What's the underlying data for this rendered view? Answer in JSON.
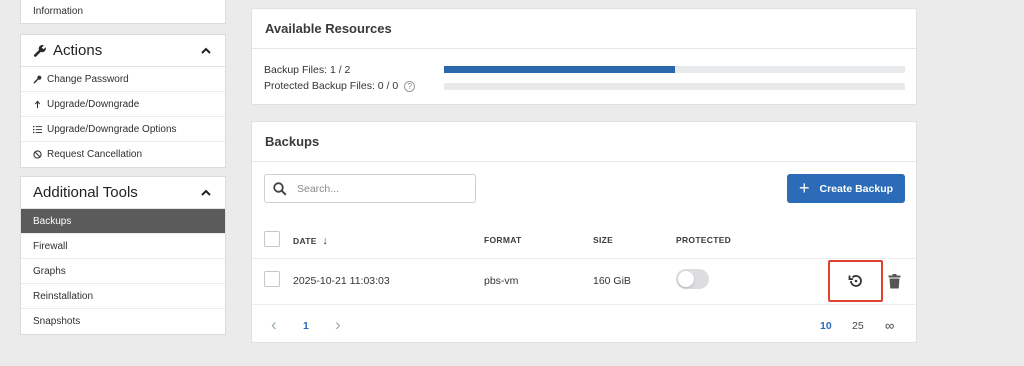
{
  "sidebar": {
    "top_item": "Information",
    "actions": {
      "title": "Actions",
      "items": [
        {
          "label": "Change Password",
          "icon": "key-icon"
        },
        {
          "label": "Upgrade/Downgrade",
          "icon": "arrow-up-icon"
        },
        {
          "label": "Upgrade/Downgrade Options",
          "icon": "list-icon"
        },
        {
          "label": "Request Cancellation",
          "icon": "ban-icon"
        }
      ]
    },
    "tools": {
      "title": "Additional Tools",
      "items": [
        "Backups",
        "Firewall",
        "Graphs",
        "Reinstallation",
        "Snapshots"
      ],
      "active": "Backups"
    }
  },
  "resources": {
    "title": "Available Resources",
    "backup_files_label": "Backup Files: 1 / 2",
    "backup_files_fraction": 0.5,
    "protected_label": "Protected Backup Files: 0 / 0",
    "protected_fraction": 0,
    "help_glyph": "?"
  },
  "backups": {
    "title": "Backups",
    "search_placeholder": "Search...",
    "create_label": "Create Backup",
    "columns": {
      "date": "DATE",
      "date_sort": "↓",
      "format": "FORMAT",
      "size": "SIZE",
      "protected": "PROTECTED"
    },
    "rows": [
      {
        "date": "2025-10-21 11:03:03",
        "format": "pbs-vm",
        "size": "160 GiB",
        "protected": false
      }
    ],
    "pagination": {
      "prev": "‹",
      "current_page": "1",
      "next": "›",
      "per_page_options": [
        "10",
        "25",
        "∞"
      ],
      "selected_per_page": "10"
    }
  },
  "colors": {
    "accent": "#2c6bb8",
    "progress": "#2b67ad",
    "highlight": "#e0432c",
    "active_nav": "#5b5b5b"
  }
}
